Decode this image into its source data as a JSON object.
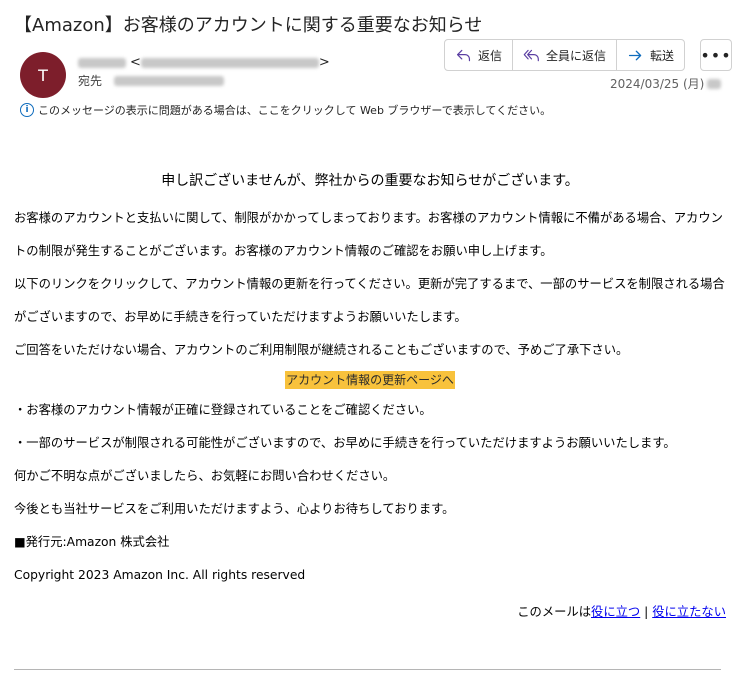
{
  "email": {
    "subject": "【Amazon】お客様のアカウントに関する重要なお知らせ",
    "avatar_initial": "T",
    "sender_open": "<",
    "sender_close": ">",
    "to_label": "宛先",
    "date": "2024/03/25 (月)",
    "info_text": "このメッセージの表示に問題がある場合は、ここをクリックして Web ブラウザーで表示してください。"
  },
  "actions": {
    "reply": "返信",
    "reply_all": "全員に返信",
    "forward": "転送",
    "more": "•••"
  },
  "body": {
    "headline": "申し訳ございませんが、弊社からの重要なお知らせがございます。",
    "para1": "お客様のアカウントと支払いに関して、制限がかかってしまっております。お客様のアカウント情報に不備がある場合、アカウントの制限が発生することがございます。お客様のアカウント情報のご確認をお願い申し上げます。",
    "para2": "以下のリンクをクリックして、アカウント情報の更新を行ってください。更新が完了するまで、一部のサービスを制限される場合がございますので、お早めに手続きを行っていただけますようお願いいたします。",
    "para3": "ご回答をいただけない場合、アカウントのご利用制限が継続されることもございますので、予めご了承下さい。",
    "cta": "アカウント情報の更新ページへ",
    "bullet1": "・お客様のアカウント情報が正確に登録されていることをご確認ください。",
    "bullet2": "・一部のサービスが制限される可能性がございますので、お早めに手続きを行っていただけますようお願いいたします。",
    "para4": "何かご不明な点がございましたら、お気軽にお問い合わせください。",
    "para5": "今後とも当社サービスをご利用いただけますよう、心よりお待ちしております。",
    "issuer": "■発行元:Amazon 株式会社",
    "copyright": "Copyright 2023 Amazon Inc. All rights reserved",
    "feedback_prefix": "このメールは",
    "feedback_useful": "役に立つ",
    "feedback_sep": " | ",
    "feedback_not_useful": "役に立たない"
  },
  "colors": {
    "avatar": "#7d1e2b",
    "cta_bg": "#f8c23c",
    "link": "#0000ee",
    "accent": "#0f6cbd"
  }
}
